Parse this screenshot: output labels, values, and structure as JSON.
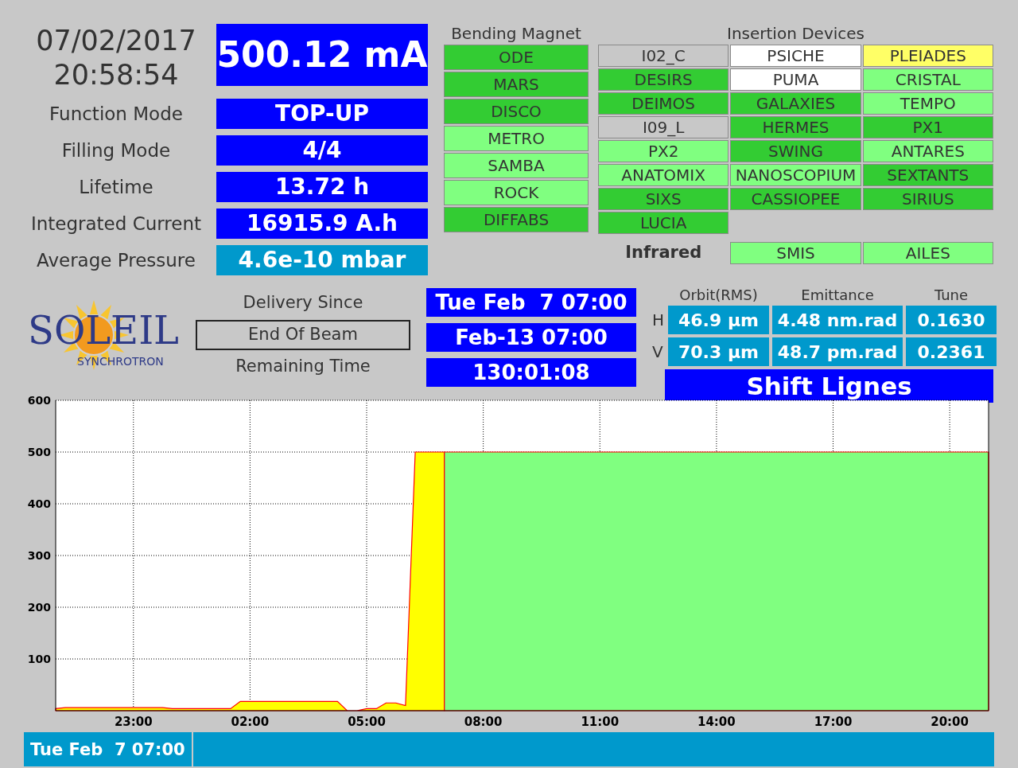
{
  "clock": {
    "date": "07/02/2017",
    "time": "20:58:54"
  },
  "beam_current": "500.12 mA",
  "parameters": [
    {
      "label": "Function Mode",
      "value": "TOP-UP",
      "color": "#0000ff"
    },
    {
      "label": "Filling Mode",
      "value": "4/4",
      "color": "#0000ff"
    },
    {
      "label": "Lifetime",
      "value": "13.72 h",
      "color": "#0000ff"
    },
    {
      "label": "Integrated Current",
      "value": "16915.9 A.h",
      "color": "#0000ff"
    },
    {
      "label": "Average Pressure",
      "value": "4.6e-10 mbar",
      "color": "#0099cc"
    }
  ],
  "bending_magnet": {
    "title": "Bending Magnet",
    "items": [
      {
        "label": "ODE",
        "color": "#33cc33"
      },
      {
        "label": "MARS",
        "color": "#33cc33"
      },
      {
        "label": "DISCO",
        "color": "#33cc33"
      },
      {
        "label": "METRO",
        "color": "#80ff80"
      },
      {
        "label": "SAMBA",
        "color": "#80ff80"
      },
      {
        "label": "ROCK",
        "color": "#80ff80"
      },
      {
        "label": "DIFFABS",
        "color": "#33cc33"
      }
    ]
  },
  "insertion_devices": {
    "title": "Insertion Devices",
    "items": [
      {
        "label": "I02_C",
        "color": "#c8c8c8"
      },
      {
        "label": "PSICHE",
        "color": "#ffffff"
      },
      {
        "label": "PLEIADES",
        "color": "#ffff66"
      },
      {
        "label": "DESIRS",
        "color": "#33cc33"
      },
      {
        "label": "PUMA",
        "color": "#ffffff"
      },
      {
        "label": "CRISTAL",
        "color": "#80ff80"
      },
      {
        "label": "DEIMOS",
        "color": "#33cc33"
      },
      {
        "label": "GALAXIES",
        "color": "#33cc33"
      },
      {
        "label": "TEMPO",
        "color": "#80ff80"
      },
      {
        "label": "I09_L",
        "color": "#c8c8c8"
      },
      {
        "label": "HERMES",
        "color": "#33cc33"
      },
      {
        "label": "PX1",
        "color": "#33cc33"
      },
      {
        "label": "PX2",
        "color": "#80ff80"
      },
      {
        "label": "SWING",
        "color": "#33cc33"
      },
      {
        "label": "ANTARES",
        "color": "#80ff80"
      },
      {
        "label": "ANATOMIX",
        "color": "#80ff80"
      },
      {
        "label": "NANOSCOPIUM",
        "color": "#80ff80"
      },
      {
        "label": "SEXTANTS",
        "color": "#33cc33"
      },
      {
        "label": "SIXS",
        "color": "#33cc33"
      },
      {
        "label": "CASSIOPEE",
        "color": "#33cc33"
      },
      {
        "label": "SIRIUS",
        "color": "#33cc33"
      },
      {
        "label": "LUCIA",
        "color": "#33cc33"
      }
    ]
  },
  "infrared": {
    "title": "Infrared",
    "items": [
      {
        "label": "SMIS",
        "color": "#80ff80"
      },
      {
        "label": "AILES",
        "color": "#80ff80"
      }
    ]
  },
  "logo": {
    "name": "SOLEIL",
    "subtitle": "SYNCHROTRON"
  },
  "delivery": [
    {
      "label": "Delivery Since",
      "boxed": false,
      "value": "Tue Feb  7 07:00"
    },
    {
      "label": "End Of Beam",
      "boxed": true,
      "value": "Feb-13 07:00"
    },
    {
      "label": "Remaining Time",
      "boxed": false,
      "value": "130:01:08"
    }
  ],
  "beam_stats": {
    "columns": [
      "Orbit(RMS)",
      "Emittance",
      "Tune"
    ],
    "rows": [
      {
        "plane": "H",
        "values": [
          "46.9 µm",
          "4.48 nm.rad",
          "0.1630"
        ]
      },
      {
        "plane": "V",
        "values": [
          "70.3 µm",
          "48.7 pm.rad",
          "0.2361"
        ]
      }
    ],
    "mode": "Shift Lignes"
  },
  "chart_data": {
    "type": "area",
    "categories": [
      null,
      null,
      null,
      null,
      null,
      null,
      null,
      null,
      "23:00",
      null,
      null,
      null,
      null,
      null,
      null,
      null,
      null,
      null,
      null,
      null,
      "02:00",
      null,
      null,
      null,
      null,
      null,
      null,
      null,
      null,
      null,
      null,
      null,
      "05:00",
      null,
      null,
      null,
      null,
      null,
      null,
      null,
      null,
      null,
      null,
      null,
      "08:00",
      null,
      null,
      null,
      null,
      null,
      null,
      null,
      null,
      null,
      null,
      null,
      "11:00",
      null,
      null,
      null,
      null,
      null,
      null,
      null,
      null,
      null,
      null,
      null,
      "14:00",
      null,
      null,
      null,
      null,
      null,
      null,
      null,
      null,
      null,
      null,
      null,
      "17:00",
      null,
      null,
      null,
      null,
      null,
      null,
      null,
      null,
      null,
      null,
      null,
      "20:00",
      null,
      null,
      null,
      null
    ],
    "series": [
      {
        "color": "#ffff00",
        "values": [
          4,
          6,
          6,
          6,
          6,
          6,
          6,
          6,
          6,
          6,
          6,
          6,
          4,
          4,
          4,
          4,
          4,
          4,
          4,
          18,
          18,
          18,
          18,
          18,
          18,
          18,
          18,
          18,
          18,
          18,
          0,
          0,
          4,
          4,
          15,
          15,
          10,
          500,
          500,
          500,
          500,
          null,
          null,
          null,
          null,
          null,
          null,
          null,
          null,
          null,
          null,
          null,
          null,
          null,
          null,
          null,
          null,
          null,
          null,
          null,
          null,
          null,
          null,
          null,
          null,
          null,
          null,
          null,
          null,
          null,
          null,
          null,
          null,
          null,
          null,
          null,
          null,
          null,
          null,
          null,
          null,
          null,
          null,
          null,
          null,
          null,
          null,
          null,
          null,
          null,
          null,
          null,
          null,
          null,
          null,
          null,
          null
        ]
      },
      {
        "color": "#80ff80",
        "values": [
          null,
          null,
          null,
          null,
          null,
          null,
          null,
          null,
          null,
          null,
          null,
          null,
          null,
          null,
          null,
          null,
          null,
          null,
          null,
          null,
          null,
          null,
          null,
          null,
          null,
          null,
          null,
          null,
          null,
          null,
          null,
          null,
          null,
          null,
          null,
          null,
          null,
          null,
          null,
          null,
          500,
          500,
          500,
          500,
          500,
          500,
          500,
          500,
          500,
          500,
          500,
          500,
          500,
          500,
          500,
          500,
          500,
          500,
          500,
          500,
          500,
          500,
          500,
          500,
          500,
          500,
          500,
          500,
          500,
          500,
          500,
          500,
          500,
          500,
          500,
          500,
          500,
          500,
          500,
          500,
          500,
          500,
          500,
          500,
          500,
          500,
          500,
          500,
          500,
          500,
          500,
          500,
          500,
          500,
          500,
          500,
          500
        ]
      }
    ],
    "ylim": [
      0,
      600
    ],
    "grid": true,
    "yticks": [
      100,
      200,
      300,
      400,
      500,
      600
    ]
  },
  "footer": {
    "date": "Tue Feb  7 07:00"
  }
}
